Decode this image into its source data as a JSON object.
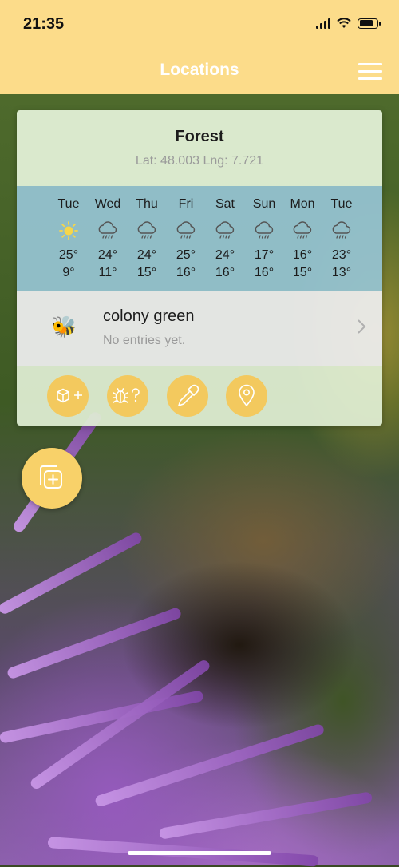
{
  "status": {
    "time": "21:35"
  },
  "nav": {
    "title": "Locations",
    "menu_icon": "hamburger-menu-icon"
  },
  "location": {
    "name": "Forest",
    "coords": "Lat: 48.003 Lng: 7.721"
  },
  "forecast": [
    {
      "day": "Tue",
      "icon": "sun-icon",
      "high": "25°",
      "low": "9°"
    },
    {
      "day": "Wed",
      "icon": "rain-cloud-icon",
      "high": "24°",
      "low": "11°"
    },
    {
      "day": "Thu",
      "icon": "rain-cloud-icon",
      "high": "24°",
      "low": "15°"
    },
    {
      "day": "Fri",
      "icon": "rain-cloud-icon",
      "high": "25°",
      "low": "16°"
    },
    {
      "day": "Sat",
      "icon": "rain-cloud-icon",
      "high": "24°",
      "low": "16°"
    },
    {
      "day": "Sun",
      "icon": "rain-cloud-icon",
      "high": "17°",
      "low": "16°"
    },
    {
      "day": "Mon",
      "icon": "rain-cloud-icon",
      "high": "16°",
      "low": "15°"
    },
    {
      "day": "Tue",
      "icon": "rain-cloud-icon",
      "high": "23°",
      "low": "13°"
    }
  ],
  "colony": {
    "name": "colony green",
    "subtitle": "No entries yet.",
    "icon": "bee-icon"
  },
  "actions": [
    {
      "name": "add-hive-button",
      "icon": "cube-plus-icon"
    },
    {
      "name": "bug-query-button",
      "icon": "bug-question-icon"
    },
    {
      "name": "pipette-button",
      "icon": "pipette-icon"
    },
    {
      "name": "location-pin-button",
      "icon": "location-pin-icon"
    }
  ],
  "fab": {
    "icon": "add-copy-icon"
  },
  "colors": {
    "accent": "#fcdc8a",
    "button": "#f3c95e",
    "forecast_bg": "#96c4d3"
  }
}
